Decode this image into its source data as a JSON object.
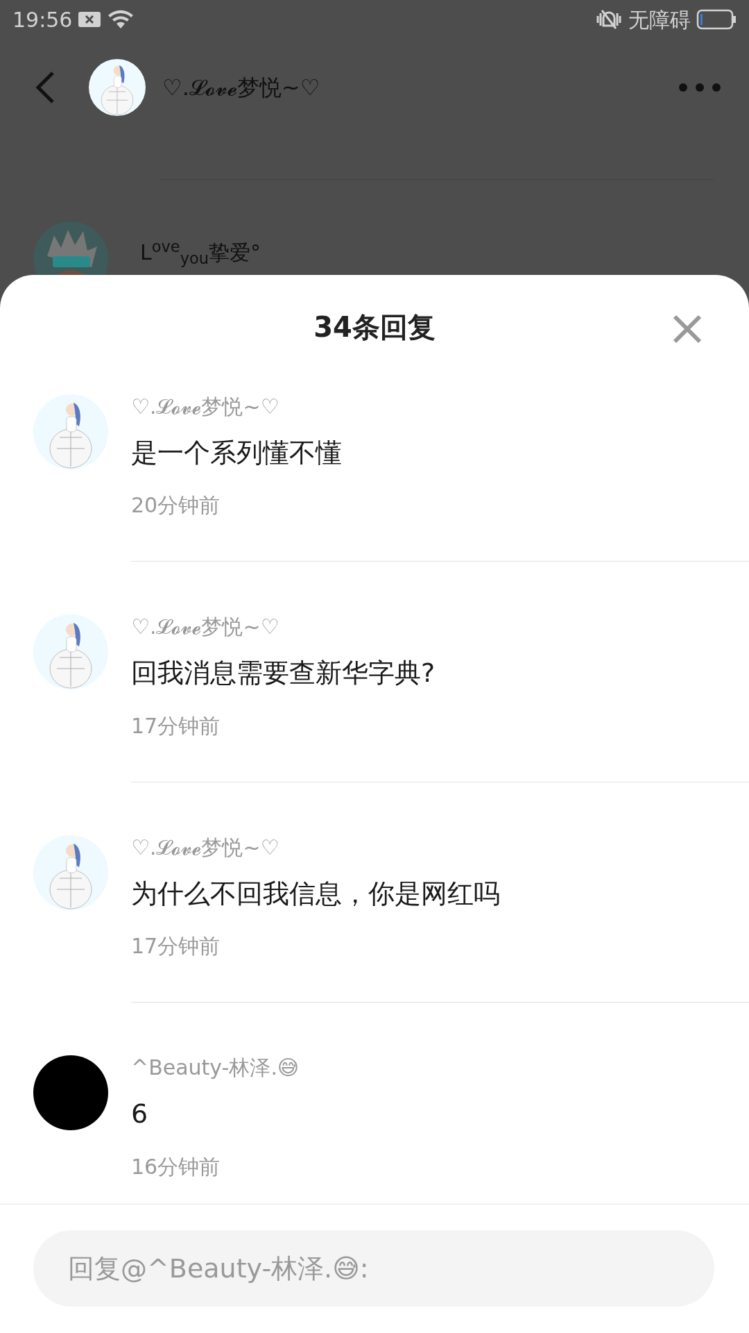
{
  "status_bar": {
    "time": "19:56",
    "accessibility": "无障碍"
  },
  "background": {
    "title": "♡.𝓛𝓸𝓿𝓮梦悦~♡",
    "comment_name": "L$^{ove}$$_{you}$挚爱°"
  },
  "sheet": {
    "title": "34条回复"
  },
  "replies": [
    {
      "name": "♡.𝓛𝓸𝓿𝓮梦悦~♡",
      "text": "是一个系列懂不懂",
      "time": "20分钟前",
      "kind": "picture"
    },
    {
      "name": "♡.𝓛𝓸𝓿𝓮梦悦~♡",
      "text": "回我消息需要查新华字典?",
      "time": "17分钟前",
      "kind": "picture"
    },
    {
      "name": "♡.𝓛𝓸𝓿𝓮梦悦~♡",
      "text": "为什么不回我信息，你是网红吗",
      "time": "17分钟前",
      "kind": "picture"
    },
    {
      "name": "^Beauty-林泽.😅",
      "text": "6",
      "time": "16分钟前",
      "kind": "blank"
    }
  ],
  "reply_field": {
    "placeholder": "回复@^Beauty-林泽.😅:"
  }
}
